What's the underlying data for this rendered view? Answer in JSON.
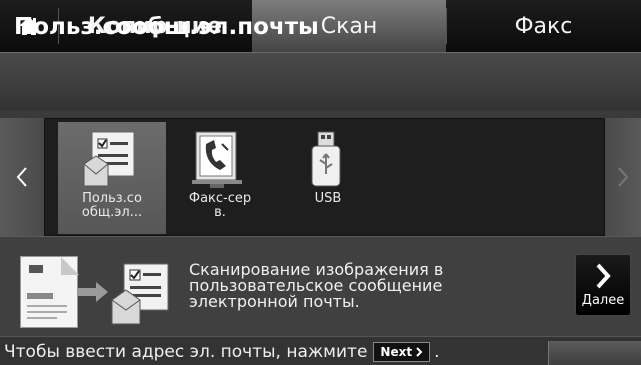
{
  "tabs": {
    "home_icon": "home-icon",
    "copy": "Копир-ние",
    "scan": "Скан",
    "fax": "Факс",
    "active": "scan"
  },
  "title": "Польз.сообщ.эл.почты",
  "carousel": {
    "items": [
      {
        "label_line1": "Польз.со",
        "label_line2": "общ.эл...",
        "icon": "user-email-icon",
        "selected": true
      },
      {
        "label_line1": "Факс-сер",
        "label_line2": "в.",
        "icon": "fax-server-icon",
        "selected": false
      },
      {
        "label_line1": "USB",
        "label_line2": "",
        "icon": "usb-icon",
        "selected": false
      }
    ]
  },
  "description": {
    "line1": "Сканирование изображения в",
    "line2": "пользовательское сообщение",
    "line3": "электронной почты."
  },
  "next_button": {
    "label": "Далее"
  },
  "footer": {
    "hint_before": "Чтобы ввести адрес эл. почты, нажмите",
    "chip": "Next",
    "hint_after": "."
  }
}
